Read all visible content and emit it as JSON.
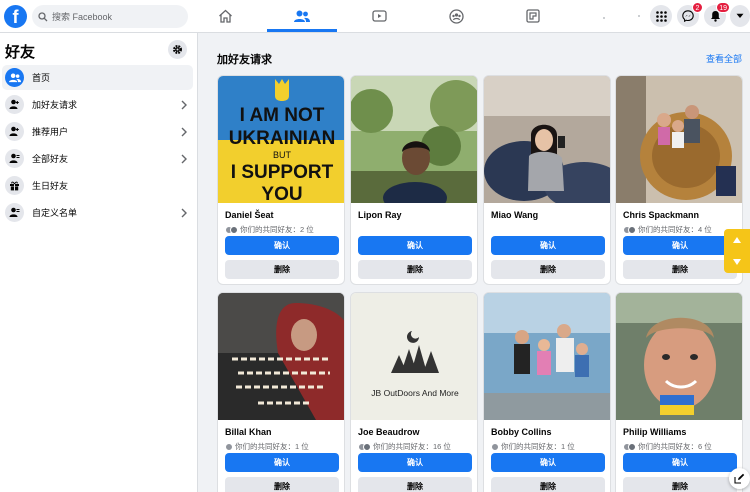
{
  "search": {
    "placeholder": "搜索 Facebook"
  },
  "brand": {
    "logo_letter": "f",
    "color": "#1877f2"
  },
  "topnav": {
    "tabs": [
      {
        "icon": "home-icon"
      },
      {
        "icon": "friends-icon",
        "active": true
      },
      {
        "icon": "watch-icon"
      },
      {
        "icon": "groups-icon"
      },
      {
        "icon": "gaming-icon"
      }
    ],
    "messenger_badge": "2",
    "notifications_badge": "19"
  },
  "sidebar": {
    "title": "好友",
    "items": [
      {
        "label": "首页",
        "icon": "friends-icon",
        "active": true,
        "chevron": false
      },
      {
        "label": "加好友请求",
        "icon": "person-add-icon",
        "chevron": true
      },
      {
        "label": "推荐用户",
        "icon": "person-plus-icon",
        "chevron": true
      },
      {
        "label": "全部好友",
        "icon": "person-list-icon",
        "chevron": true
      },
      {
        "label": "生日好友",
        "icon": "gift-icon",
        "chevron": false
      },
      {
        "label": "自定义名单",
        "icon": "person-list-icon",
        "chevron": true
      }
    ]
  },
  "main": {
    "section_title": "加好友请求",
    "see_all": "查看全部",
    "confirm_label": "确认",
    "delete_label": "删除",
    "photo_texts": {
      "ukraine_line1": "I AM NOT",
      "ukraine_line2": "UKRAINIAN",
      "ukraine_line3": "BUT",
      "ukraine_line4": "I SUPPORT",
      "ukraine_line5": "YOU",
      "jb_logo": "JB OutDoors And More"
    },
    "requests": [
      {
        "name": "Daniel Šeat",
        "mutual": "你们的共同好友：2 位"
      },
      {
        "name": "Lipon Ray",
        "mutual": ""
      },
      {
        "name": "Miao Wang",
        "mutual": ""
      },
      {
        "name": "Chris Spackmann",
        "mutual": "你们的共同好友：4 位"
      },
      {
        "name": "Billal Khan",
        "mutual": "你们的共同好友：1 位"
      },
      {
        "name": "Joe Beaudrow",
        "mutual": "你们的共同好友：16 位"
      },
      {
        "name": "Bobby Collins",
        "mutual": "你们的共同好友：1 位"
      },
      {
        "name": "Philip Williams",
        "mutual": "你们的共同好友：6 位"
      }
    ]
  }
}
